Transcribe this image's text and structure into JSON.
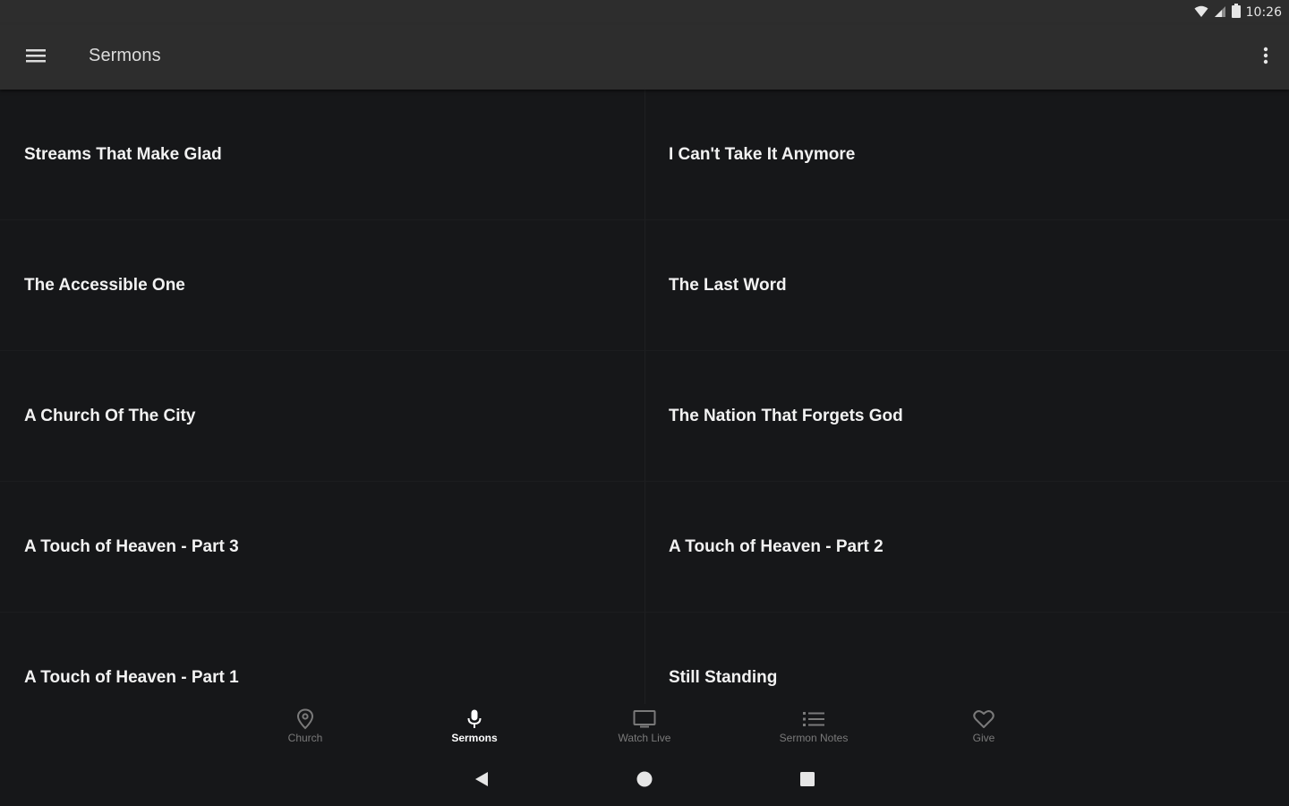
{
  "status_bar": {
    "time": "10:26"
  },
  "app_bar": {
    "title": "Sermons"
  },
  "sermons": [
    {
      "title": "Streams That Make Glad"
    },
    {
      "title": "I Can't Take It Anymore"
    },
    {
      "title": "The Accessible One"
    },
    {
      "title": "The Last Word"
    },
    {
      "title": "A Church Of The City"
    },
    {
      "title": "The Nation That Forgets God"
    },
    {
      "title": "A Touch of Heaven - Part 3"
    },
    {
      "title": "A Touch of Heaven - Part 2"
    },
    {
      "title": "A Touch of Heaven - Part 1"
    },
    {
      "title": "Still Standing"
    }
  ],
  "bottom_nav": {
    "items": [
      {
        "label": "Church",
        "icon": "location-pin-icon",
        "active": false
      },
      {
        "label": "Sermons",
        "icon": "microphone-icon",
        "active": true
      },
      {
        "label": "Watch Live",
        "icon": "monitor-icon",
        "active": false
      },
      {
        "label": "Sermon Notes",
        "icon": "list-icon",
        "active": false
      },
      {
        "label": "Give",
        "icon": "heart-icon",
        "active": false
      }
    ]
  },
  "colors": {
    "app_bar": "#2d2d2d",
    "background": "#161719",
    "text_primary": "#f2f2f2",
    "nav_inactive": "#7a7a7a",
    "nav_active": "#ffffff"
  }
}
